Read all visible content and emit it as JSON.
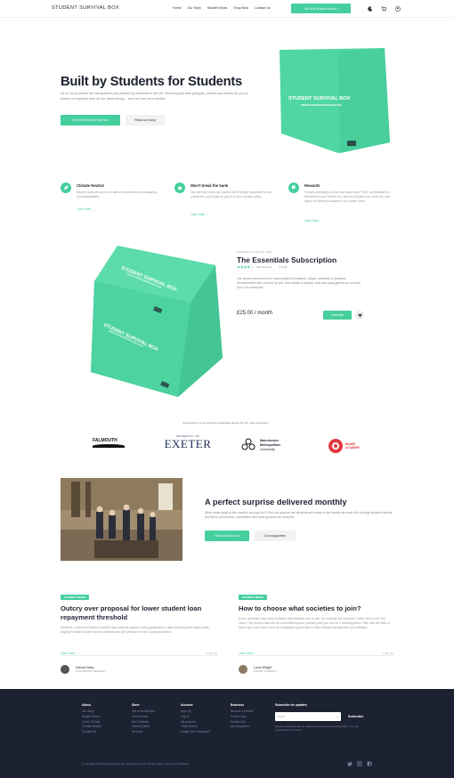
{
  "nav": {
    "brand": "STUDENT SURVIVAL BOX",
    "links": [
      "Home",
      "Our Story",
      "Student News",
      "Shop Now",
      "Contact Us"
    ],
    "cta": "Get 10% off your first box ›"
  },
  "hero": {
    "title": "Built by Students for Students",
    "subtitle": "All of our products are handpicked and packed by students in the UK. Sourcing the best gadgets, snacks and drinks for you to ensure no repeats from all our latest things... and we love your smiles!",
    "primary_cta": "Get 10% off your first box",
    "secondary_cta": "Read our story",
    "box_label": "STUDENT SURVIVAL BOX",
    "box_sublabel": "WWW.STUDENTSURVIVALBOX.COM"
  },
  "features": [
    {
      "icon": "leaf-icon",
      "title": "Climate Neutral",
      "text": "Student survival box is run carbon neutral and all packaging is biodegradable.",
      "link": "Learn More →"
    },
    {
      "icon": "piggy-bank-icon",
      "title": "Won't break the bank",
      "text": "Our survival boxes are packed full of things requested by our customers, you'll want to pick it to your monthly plans.",
      "link": "Learn More →"
    },
    {
      "icon": "reward-icon",
      "title": "Rewards",
      "text": "Found something you like and want more? Give us feedback for the items in your recent box, and we will give you credit you can spend on direct purchases in our online store.",
      "link": "Learn More →"
    }
  ],
  "product": {
    "kicker": "STUDENT SURVIVAL BOX",
    "title": "The Essentials Subscription",
    "rating": 4.5,
    "reviews": "366 Reviews",
    "description": "Our student survival box is hand-picked and packed, unique collection of products recommended and sourced by you, from drinks to snacks, tech and party games our survival box is for everyone!",
    "price": "£25.00 / month",
    "subscribe": "Subscribe",
    "box_label": "STUDENT SURVIVAL BOX",
    "box_sublabel": "WWW.STUDENTSURVIVALBOX.COM"
  },
  "partners": {
    "caption": "Supported by some amazing universities across the UK. See supporters →",
    "logos": [
      "FALMOUTH",
      "UNIVERSITY OF",
      "EXETER",
      "Manchester",
      "Metropolitan",
      "University",
      "BANES",
      "ACADEMY"
    ]
  },
  "surprise": {
    "title": "A perfect surprise delivered monthly",
    "text": "What treats await in this month's survival box? Find out what we are all about and some of the brands we work with, through student survival box items, promotions, newsletters and more goodies are included.",
    "primary": "Get your first box",
    "secondary": "Our supporters"
  },
  "articles": [
    {
      "tag": "STUDENT NEWS",
      "title": "Outcry over proposal for lower student loan repayment threshold",
      "text": "Students, unions and finance experts have warned against forcing graduates to start repaying their loans earlier, saying it would hit lower earners hardest and pile pressure on the Covid generation.",
      "link": "Learn More →",
      "stats": "1.2K  |  12",
      "author": "Danny Daley",
      "author_meta": "MANCHESTER UNIVERSITY"
    },
    {
      "tag": "STUDENT NEWS",
      "title": "How to choose what societies to join?",
      "text": "Every university has many societies that students love to join, for example the Students' Union offers over 200 clubs. The choices that can be overwhelming and pressing and you can be a deciding factor. Still, with the help of these tips, you'll soon see it as a fantastic opportunity to make friends and discover your abilities.",
      "link": "Learn More →",
      "stats": "1.2K  |  12",
      "author": "Louis Wright",
      "author_meta": "EXETER UNIVERSITY"
    }
  ],
  "footer": {
    "columns": [
      {
        "heading": "About",
        "items": [
          "Our Story",
          "Student News",
          "Covid-19 Help",
          "Climate Neutral",
          "Contact Us"
        ]
      },
      {
        "heading": "Store",
        "items": [
          "Gift a Survival Box",
          "How it works",
          "Box Contents",
          "Special Offers",
          "Reviews"
        ]
      },
      {
        "heading": "Account",
        "items": [
          "Sign Up",
          "Log In",
          "My Account",
          "Track Orders",
          "Forgot Your Password?"
        ]
      },
      {
        "heading": "Business",
        "items": [
          "Become a Partner",
          "Promo Code",
          "Partner Info",
          "Our Supporters"
        ]
      }
    ],
    "newsletter_heading": "Subscribe for updates",
    "email_placeholder": "Email",
    "subscribe": "Subscribe",
    "newsletter_text": "Receive occasional tips on student life and exclusive special offers. You can unsubscribe at any time.",
    "copyright": "© Copyright 2022 Student Survival Box. All rights reserved. Privacy Policy | Terms and Conditions"
  },
  "colors": {
    "accent": "#45cf9d",
    "footer_bg": "#1d2233",
    "box": "#4fd6a2",
    "box_dark": "#3cbf8c"
  }
}
